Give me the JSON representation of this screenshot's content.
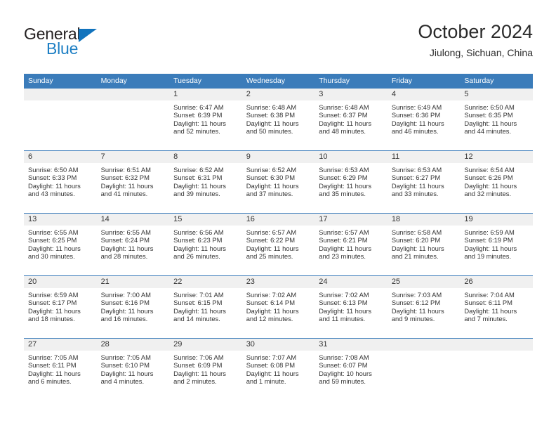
{
  "brand": {
    "name_top": "General",
    "name_bottom": "Blue",
    "accent_color": "#1d7fc4",
    "triangle_color": "#1173bd"
  },
  "header": {
    "title": "October 2024",
    "subtitle": "Jiulong, Sichuan, China"
  },
  "theme": {
    "header_bg": "#3b7cba",
    "daynum_bg": "#f0f0f0",
    "text_color": "#333333"
  },
  "weekday_headers": [
    "Sunday",
    "Monday",
    "Tuesday",
    "Wednesday",
    "Thursday",
    "Friday",
    "Saturday"
  ],
  "weeks": [
    [
      {
        "day": "",
        "sunrise": "",
        "sunset": "",
        "daylight_line1": "",
        "daylight_line2": ""
      },
      {
        "day": "",
        "sunrise": "",
        "sunset": "",
        "daylight_line1": "",
        "daylight_line2": ""
      },
      {
        "day": "1",
        "sunrise": "Sunrise: 6:47 AM",
        "sunset": "Sunset: 6:39 PM",
        "daylight_line1": "Daylight: 11 hours",
        "daylight_line2": "and 52 minutes."
      },
      {
        "day": "2",
        "sunrise": "Sunrise: 6:48 AM",
        "sunset": "Sunset: 6:38 PM",
        "daylight_line1": "Daylight: 11 hours",
        "daylight_line2": "and 50 minutes."
      },
      {
        "day": "3",
        "sunrise": "Sunrise: 6:48 AM",
        "sunset": "Sunset: 6:37 PM",
        "daylight_line1": "Daylight: 11 hours",
        "daylight_line2": "and 48 minutes."
      },
      {
        "day": "4",
        "sunrise": "Sunrise: 6:49 AM",
        "sunset": "Sunset: 6:36 PM",
        "daylight_line1": "Daylight: 11 hours",
        "daylight_line2": "and 46 minutes."
      },
      {
        "day": "5",
        "sunrise": "Sunrise: 6:50 AM",
        "sunset": "Sunset: 6:35 PM",
        "daylight_line1": "Daylight: 11 hours",
        "daylight_line2": "and 44 minutes."
      }
    ],
    [
      {
        "day": "6",
        "sunrise": "Sunrise: 6:50 AM",
        "sunset": "Sunset: 6:33 PM",
        "daylight_line1": "Daylight: 11 hours",
        "daylight_line2": "and 43 minutes."
      },
      {
        "day": "7",
        "sunrise": "Sunrise: 6:51 AM",
        "sunset": "Sunset: 6:32 PM",
        "daylight_line1": "Daylight: 11 hours",
        "daylight_line2": "and 41 minutes."
      },
      {
        "day": "8",
        "sunrise": "Sunrise: 6:52 AM",
        "sunset": "Sunset: 6:31 PM",
        "daylight_line1": "Daylight: 11 hours",
        "daylight_line2": "and 39 minutes."
      },
      {
        "day": "9",
        "sunrise": "Sunrise: 6:52 AM",
        "sunset": "Sunset: 6:30 PM",
        "daylight_line1": "Daylight: 11 hours",
        "daylight_line2": "and 37 minutes."
      },
      {
        "day": "10",
        "sunrise": "Sunrise: 6:53 AM",
        "sunset": "Sunset: 6:29 PM",
        "daylight_line1": "Daylight: 11 hours",
        "daylight_line2": "and 35 minutes."
      },
      {
        "day": "11",
        "sunrise": "Sunrise: 6:53 AM",
        "sunset": "Sunset: 6:27 PM",
        "daylight_line1": "Daylight: 11 hours",
        "daylight_line2": "and 33 minutes."
      },
      {
        "day": "12",
        "sunrise": "Sunrise: 6:54 AM",
        "sunset": "Sunset: 6:26 PM",
        "daylight_line1": "Daylight: 11 hours",
        "daylight_line2": "and 32 minutes."
      }
    ],
    [
      {
        "day": "13",
        "sunrise": "Sunrise: 6:55 AM",
        "sunset": "Sunset: 6:25 PM",
        "daylight_line1": "Daylight: 11 hours",
        "daylight_line2": "and 30 minutes."
      },
      {
        "day": "14",
        "sunrise": "Sunrise: 6:55 AM",
        "sunset": "Sunset: 6:24 PM",
        "daylight_line1": "Daylight: 11 hours",
        "daylight_line2": "and 28 minutes."
      },
      {
        "day": "15",
        "sunrise": "Sunrise: 6:56 AM",
        "sunset": "Sunset: 6:23 PM",
        "daylight_line1": "Daylight: 11 hours",
        "daylight_line2": "and 26 minutes."
      },
      {
        "day": "16",
        "sunrise": "Sunrise: 6:57 AM",
        "sunset": "Sunset: 6:22 PM",
        "daylight_line1": "Daylight: 11 hours",
        "daylight_line2": "and 25 minutes."
      },
      {
        "day": "17",
        "sunrise": "Sunrise: 6:57 AM",
        "sunset": "Sunset: 6:21 PM",
        "daylight_line1": "Daylight: 11 hours",
        "daylight_line2": "and 23 minutes."
      },
      {
        "day": "18",
        "sunrise": "Sunrise: 6:58 AM",
        "sunset": "Sunset: 6:20 PM",
        "daylight_line1": "Daylight: 11 hours",
        "daylight_line2": "and 21 minutes."
      },
      {
        "day": "19",
        "sunrise": "Sunrise: 6:59 AM",
        "sunset": "Sunset: 6:19 PM",
        "daylight_line1": "Daylight: 11 hours",
        "daylight_line2": "and 19 minutes."
      }
    ],
    [
      {
        "day": "20",
        "sunrise": "Sunrise: 6:59 AM",
        "sunset": "Sunset: 6:17 PM",
        "daylight_line1": "Daylight: 11 hours",
        "daylight_line2": "and 18 minutes."
      },
      {
        "day": "21",
        "sunrise": "Sunrise: 7:00 AM",
        "sunset": "Sunset: 6:16 PM",
        "daylight_line1": "Daylight: 11 hours",
        "daylight_line2": "and 16 minutes."
      },
      {
        "day": "22",
        "sunrise": "Sunrise: 7:01 AM",
        "sunset": "Sunset: 6:15 PM",
        "daylight_line1": "Daylight: 11 hours",
        "daylight_line2": "and 14 minutes."
      },
      {
        "day": "23",
        "sunrise": "Sunrise: 7:02 AM",
        "sunset": "Sunset: 6:14 PM",
        "daylight_line1": "Daylight: 11 hours",
        "daylight_line2": "and 12 minutes."
      },
      {
        "day": "24",
        "sunrise": "Sunrise: 7:02 AM",
        "sunset": "Sunset: 6:13 PM",
        "daylight_line1": "Daylight: 11 hours",
        "daylight_line2": "and 11 minutes."
      },
      {
        "day": "25",
        "sunrise": "Sunrise: 7:03 AM",
        "sunset": "Sunset: 6:12 PM",
        "daylight_line1": "Daylight: 11 hours",
        "daylight_line2": "and 9 minutes."
      },
      {
        "day": "26",
        "sunrise": "Sunrise: 7:04 AM",
        "sunset": "Sunset: 6:11 PM",
        "daylight_line1": "Daylight: 11 hours",
        "daylight_line2": "and 7 minutes."
      }
    ],
    [
      {
        "day": "27",
        "sunrise": "Sunrise: 7:05 AM",
        "sunset": "Sunset: 6:11 PM",
        "daylight_line1": "Daylight: 11 hours",
        "daylight_line2": "and 6 minutes."
      },
      {
        "day": "28",
        "sunrise": "Sunrise: 7:05 AM",
        "sunset": "Sunset: 6:10 PM",
        "daylight_line1": "Daylight: 11 hours",
        "daylight_line2": "and 4 minutes."
      },
      {
        "day": "29",
        "sunrise": "Sunrise: 7:06 AM",
        "sunset": "Sunset: 6:09 PM",
        "daylight_line1": "Daylight: 11 hours",
        "daylight_line2": "and 2 minutes."
      },
      {
        "day": "30",
        "sunrise": "Sunrise: 7:07 AM",
        "sunset": "Sunset: 6:08 PM",
        "daylight_line1": "Daylight: 11 hours",
        "daylight_line2": "and 1 minute."
      },
      {
        "day": "31",
        "sunrise": "Sunrise: 7:08 AM",
        "sunset": "Sunset: 6:07 PM",
        "daylight_line1": "Daylight: 10 hours",
        "daylight_line2": "and 59 minutes."
      },
      {
        "day": "",
        "sunrise": "",
        "sunset": "",
        "daylight_line1": "",
        "daylight_line2": ""
      },
      {
        "day": "",
        "sunrise": "",
        "sunset": "",
        "daylight_line1": "",
        "daylight_line2": ""
      }
    ]
  ]
}
